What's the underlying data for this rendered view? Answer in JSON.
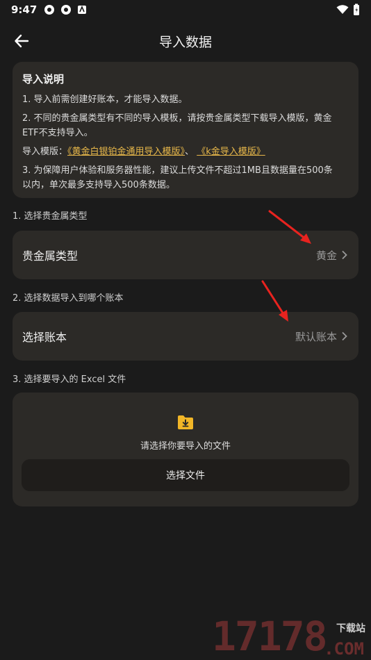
{
  "status_bar": {
    "time": "9:47"
  },
  "header": {
    "title": "导入数据"
  },
  "info": {
    "title": "导入说明",
    "line1": "1. 导入前需创建好账本，才能导入数据。",
    "line2a": "2. 不同的贵金属类型有不同的导入模板，请按贵金属类型下载导入模版，黄金",
    "line2b": "ETF不支持导入。",
    "template_prefix": "导入模版：",
    "template_link1": "《黄金白银铂金通用导入模版》",
    "template_sep": "、",
    "template_link2": "《k金导入模版》",
    "line3a": "3. 为保障用户体验和服务器性能，建议上传文件不超过1MB且数据量在500条",
    "line3b": "以内，单次最多支持导入500条数据。"
  },
  "step1": {
    "label": "1. 选择贵金属类型",
    "row_label": "贵金属类型",
    "row_value": "黄金"
  },
  "step2": {
    "label": "2. 选择数据导入到哪个账本",
    "row_label": "选择账本",
    "row_value": "默认账本"
  },
  "step3": {
    "label": "3. 选择要导入的 Excel 文件",
    "hint": "请选择你要导入的文件",
    "button": "选择文件"
  },
  "watermark": {
    "number": "17178",
    "site": "下载站",
    "com": ".COM"
  },
  "colors": {
    "background": "#1b1b1b",
    "card": "#2c2a27",
    "link": "#e8b84a",
    "annotation_arrow": "#e8231f"
  }
}
